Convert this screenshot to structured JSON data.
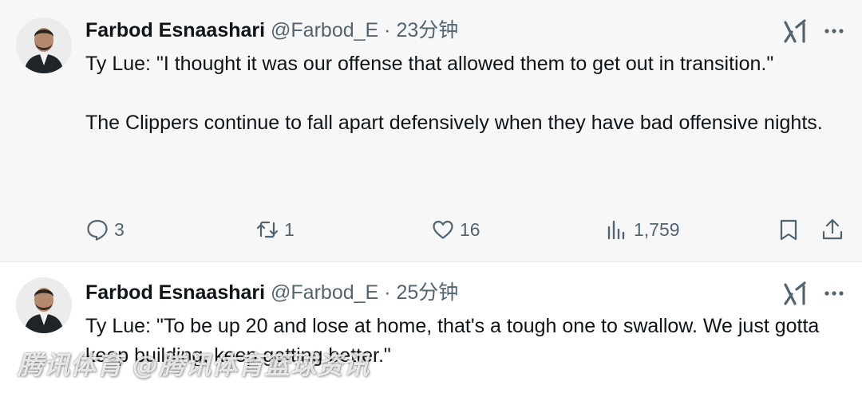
{
  "tweets": [
    {
      "author_name": "Farbod Esnaashari",
      "handle": "@Farbod_E",
      "separator": "·",
      "time": "23分钟",
      "paragraphs": [
        "Ty Lue: \"I thought it was our offense that allowed them to get out in transition.\"",
        "The Clippers continue to fall apart defensively when they have bad offensive nights."
      ],
      "actions": {
        "reply_count": "3",
        "retweet_count": "1",
        "like_count": "16",
        "views_count": "1,759"
      },
      "icons": [
        "avatar",
        "grok-icon",
        "more-icon",
        "reply-icon",
        "retweet-icon",
        "like-icon",
        "views-icon",
        "bookmark-icon",
        "share-icon"
      ]
    },
    {
      "author_name": "Farbod Esnaashari",
      "handle": "@Farbod_E",
      "separator": "·",
      "time": "25分钟",
      "paragraphs": [
        "Ty Lue: \"To be up 20 and lose at home, that's a tough one to swallow. We just gotta keep building, keep getting better.\""
      ],
      "icons": [
        "avatar",
        "grok-icon",
        "more-icon"
      ]
    }
  ],
  "watermark": "腾讯体育 @腾讯体育篮球资讯",
  "colors": {
    "text_primary": "#0f1419",
    "text_secondary": "#536471",
    "card_bg_first": "#f7f7f7",
    "card_bg_second": "#ffffff"
  }
}
